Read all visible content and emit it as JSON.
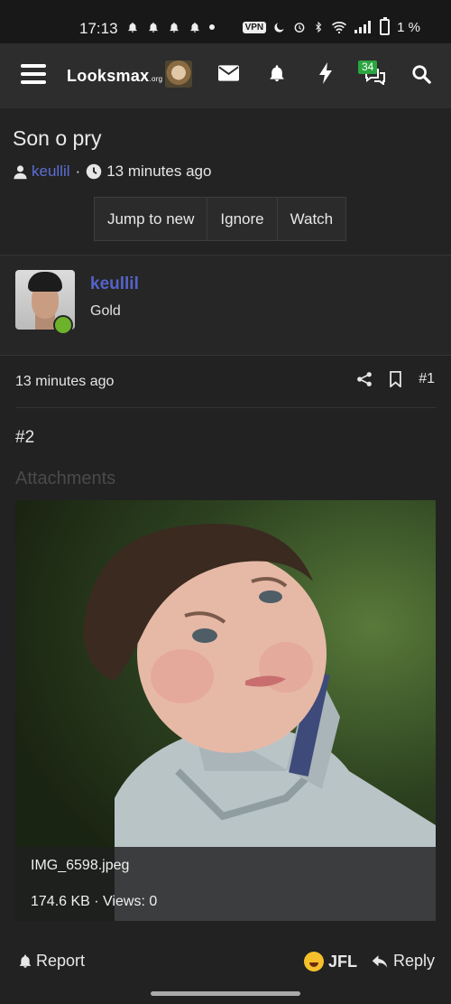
{
  "status_bar": {
    "time": "17:13",
    "vpn_label": "VPN",
    "battery": "1 %"
  },
  "navbar": {
    "logo_main": "Lo",
    "logo_rest": "oksmax",
    "logo_suffix": ".org",
    "messages_count": "34",
    "colors": {
      "background": "#2d2d2d",
      "badge": "#2aa53f"
    }
  },
  "thread": {
    "title": "Son o pry",
    "author": "keullil",
    "separator": "·",
    "time": "13 minutes ago",
    "buttons": [
      "Jump to new",
      "Ignore",
      "Watch"
    ]
  },
  "user": {
    "name": "keullil",
    "rank": "Gold",
    "online_color": "#6cb22a"
  },
  "post": {
    "time": "13 minutes ago",
    "number": "#1",
    "body": "#2",
    "attachments_heading": "Attachments",
    "attachment": {
      "filename": "IMG_6598.jpeg",
      "meta": "174.6 KB · Views: 0"
    },
    "footer": {
      "report": "Report",
      "jfl": "JFL",
      "reply": "Reply"
    }
  },
  "colors": {
    "link": "#5c6fd6",
    "username": "#5563c9"
  }
}
